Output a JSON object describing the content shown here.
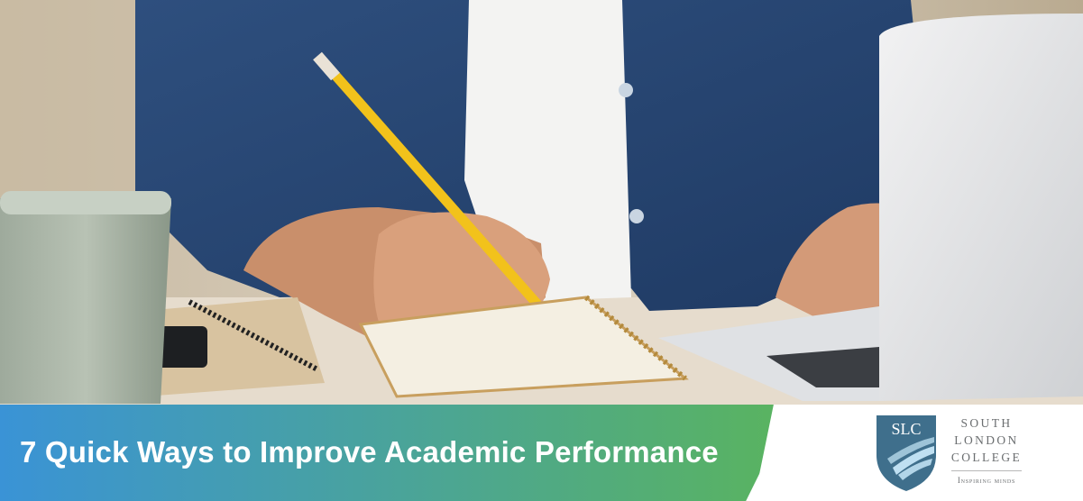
{
  "banner": {
    "title": "7 Quick Ways to Improve Academic Performance",
    "gradient_start": "#3a93d6",
    "gradient_end": "#5ab45e"
  },
  "logo": {
    "monogram": "SLC",
    "line1": "SOUTH",
    "line2": "LONDON",
    "line3": "COLLEGE",
    "tagline": "Inspiring minds",
    "shield_color": "#3f6f8c",
    "shield_accent": "#bfe0f2"
  }
}
